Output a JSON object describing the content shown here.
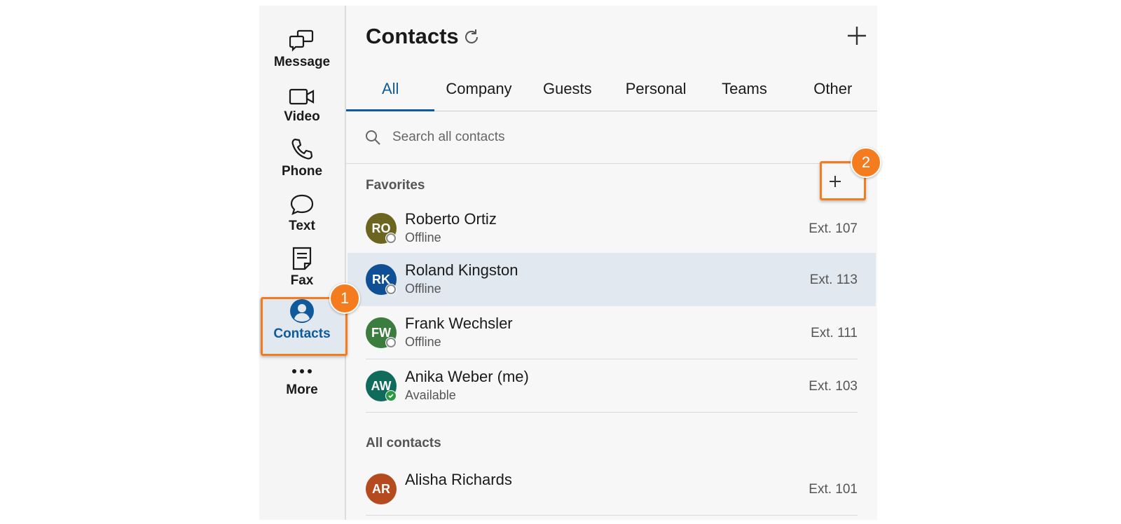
{
  "nav": [
    {
      "label": "Message",
      "icon": "message-icon"
    },
    {
      "label": "Video",
      "icon": "video-icon"
    },
    {
      "label": "Phone",
      "icon": "phone-icon"
    },
    {
      "label": "Text",
      "icon": "text-icon"
    },
    {
      "label": "Fax",
      "icon": "fax-icon"
    },
    {
      "label": "Contacts",
      "icon": "contacts-icon",
      "active": true
    },
    {
      "label": "More",
      "icon": "more-icon"
    }
  ],
  "header": {
    "title": "Contacts"
  },
  "tabs": [
    {
      "label": "All",
      "active": true
    },
    {
      "label": "Company"
    },
    {
      "label": "Guests"
    },
    {
      "label": "Personal"
    },
    {
      "label": "Teams"
    },
    {
      "label": "Other"
    }
  ],
  "search": {
    "placeholder": "Search all contacts"
  },
  "favorites": {
    "label": "Favorites",
    "contacts": [
      {
        "initials": "RO",
        "name": "Roberto Ortiz",
        "status": "Offline",
        "ext": "Ext. 107",
        "color": "#6b6520"
      },
      {
        "initials": "RK",
        "name": "Roland Kingston",
        "status": "Offline",
        "ext": "Ext. 113",
        "color": "#0e4f96",
        "selected": true
      },
      {
        "initials": "FW",
        "name": "Frank Wechsler",
        "status": "Offline",
        "ext": "Ext. 111",
        "color": "#3a7d3e"
      },
      {
        "initials": "AW",
        "name": "Anika Weber (me)",
        "status": "Available",
        "ext": "Ext. 103",
        "color": "#0f6b5c"
      }
    ]
  },
  "all_contacts": {
    "label": "All contacts",
    "contacts": [
      {
        "initials": "AR",
        "name": "Alisha Richards",
        "ext": "Ext. 101",
        "color": "#b54a1e"
      }
    ]
  },
  "callouts": {
    "step1": "1",
    "step2": "2"
  },
  "colors": {
    "accent": "#0f5a9c",
    "callout": "#f47c1f",
    "selected_row": "#e2e8ef"
  }
}
